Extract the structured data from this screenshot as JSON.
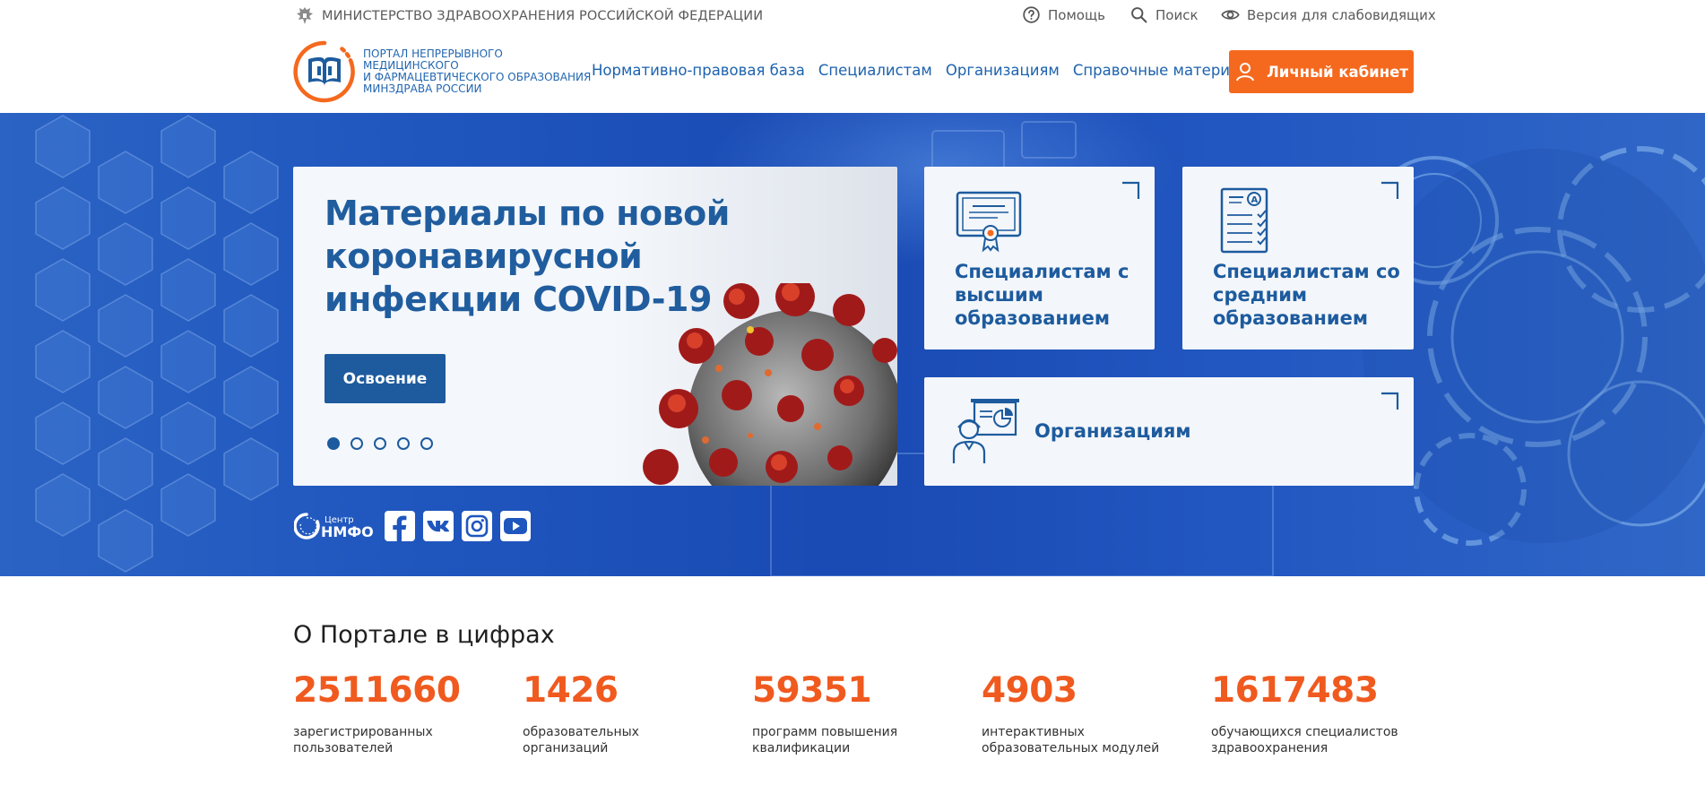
{
  "topbar": {
    "ministry": "МИНИСТЕРСТВО ЗДРАВООХРАНЕНИЯ РОССИЙСКОЙ ФЕДЕРАЦИИ",
    "help": "Помощь",
    "search": "Поиск",
    "accessibility": "Версия для слабовидящих"
  },
  "header": {
    "portal_name": [
      "ПОРТАЛ НЕПРЕРЫВНОГО",
      "МЕДИЦИНСКОГО",
      "И ФАРМАЦЕВТИЧЕСКОГО ОБРАЗОВАНИЯ",
      "МИНЗДРАВА РОССИИ"
    ],
    "nav": [
      "Нормативно-правовая база",
      "Специалистам",
      "Организациям",
      "Справочные материалы"
    ],
    "cabinet_label": "Личный кабинет"
  },
  "hero": {
    "slide_title": "Материалы по новой коронавирусной инфекции COVID-19",
    "slide_button": "Освоение",
    "slides_total": 5,
    "active_slide": 1,
    "cards": {
      "higher": "Специалистам с высшим образованием",
      "middle": "Специалистам со средним образованием",
      "orgs": "Организациям"
    },
    "nmfo_small": "Центр",
    "nmfo_big": "НМФО"
  },
  "stats": {
    "title": "О Портале в цифрах",
    "items": [
      {
        "value": "2511660",
        "label": "зарегистрированных пользователей"
      },
      {
        "value": "1426",
        "label": "образовательных организаций"
      },
      {
        "value": "59351",
        "label": "программ повышения квалификации"
      },
      {
        "value": "4903",
        "label": "интерактивных образовательных модулей"
      },
      {
        "value": "1617483",
        "label": "обучающихся специалистов здравоохранения"
      }
    ]
  },
  "colors": {
    "brand_blue": "#1d5b9e",
    "accent_orange": "#f5691e",
    "stat_orange": "#f05a1f"
  },
  "icons": [
    "emblem-icon",
    "help-icon",
    "search-icon",
    "eye-icon",
    "user-icon",
    "diploma-icon",
    "checklist-icon",
    "presentation-icon",
    "facebook-icon",
    "vk-icon",
    "instagram-icon",
    "youtube-icon"
  ]
}
